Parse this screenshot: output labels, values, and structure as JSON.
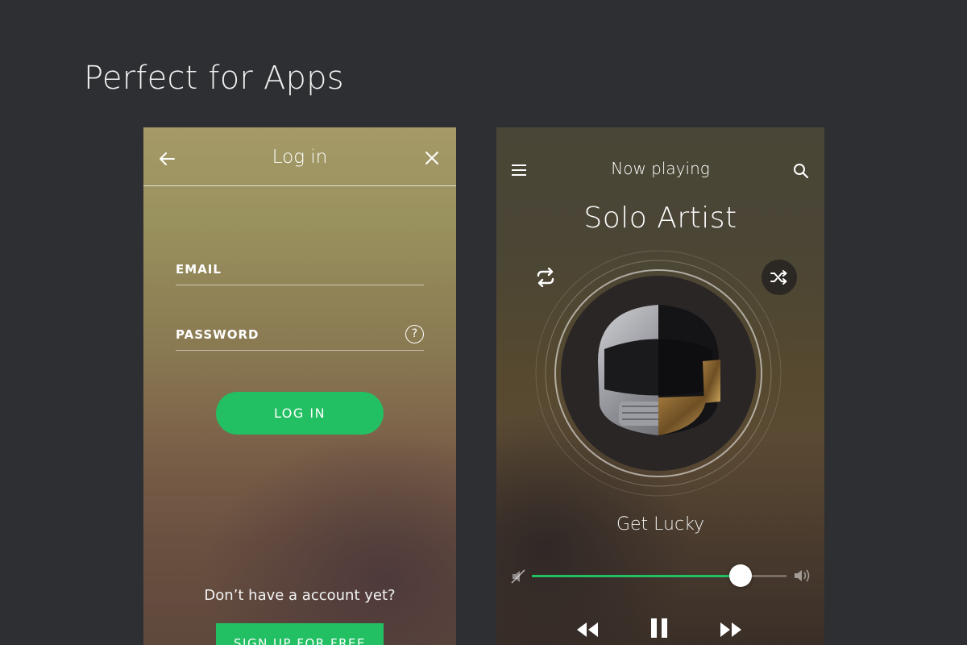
{
  "page": {
    "headline": "Perfect for Apps"
  },
  "login": {
    "title": "Log in",
    "email_placeholder": "EMAIL",
    "password_placeholder": "PASSWORD",
    "help_icon": "question-circle-icon",
    "login_button": "LOG IN",
    "no_account_text": "Don’t have a account yet?",
    "signup_button": "SIGN UP FOR FREE",
    "accent_color": "#23c063"
  },
  "player": {
    "header_title": "Now playing",
    "artist": "Solo Artist",
    "song": "Get Lucky",
    "volume_level": 0.82,
    "accent_color": "#23c063",
    "icons": [
      "menu-icon",
      "search-icon",
      "repeat-icon",
      "shuffle-icon",
      "volume-mute-icon",
      "volume-up-icon",
      "rewind-icon",
      "pause-icon",
      "fast-forward-icon"
    ]
  }
}
